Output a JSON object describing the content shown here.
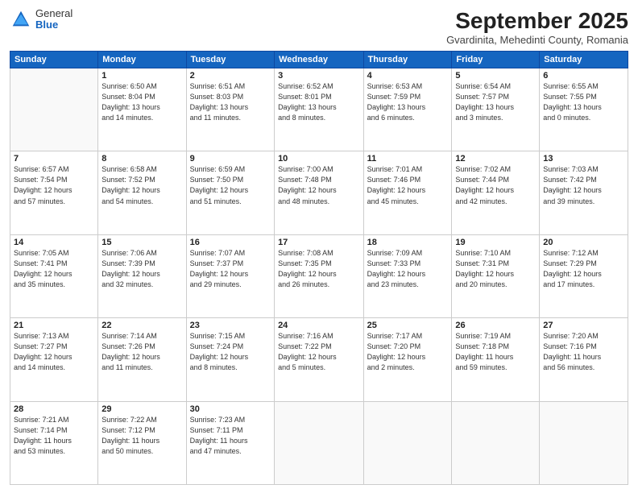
{
  "logo": {
    "general": "General",
    "blue": "Blue"
  },
  "title": "September 2025",
  "location": "Gvardinita, Mehedinti County, Romania",
  "headers": [
    "Sunday",
    "Monday",
    "Tuesday",
    "Wednesday",
    "Thursday",
    "Friday",
    "Saturday"
  ],
  "weeks": [
    [
      {
        "day": "",
        "info": ""
      },
      {
        "day": "1",
        "info": "Sunrise: 6:50 AM\nSunset: 8:04 PM\nDaylight: 13 hours\nand 14 minutes."
      },
      {
        "day": "2",
        "info": "Sunrise: 6:51 AM\nSunset: 8:03 PM\nDaylight: 13 hours\nand 11 minutes."
      },
      {
        "day": "3",
        "info": "Sunrise: 6:52 AM\nSunset: 8:01 PM\nDaylight: 13 hours\nand 8 minutes."
      },
      {
        "day": "4",
        "info": "Sunrise: 6:53 AM\nSunset: 7:59 PM\nDaylight: 13 hours\nand 6 minutes."
      },
      {
        "day": "5",
        "info": "Sunrise: 6:54 AM\nSunset: 7:57 PM\nDaylight: 13 hours\nand 3 minutes."
      },
      {
        "day": "6",
        "info": "Sunrise: 6:55 AM\nSunset: 7:55 PM\nDaylight: 13 hours\nand 0 minutes."
      }
    ],
    [
      {
        "day": "7",
        "info": "Sunrise: 6:57 AM\nSunset: 7:54 PM\nDaylight: 12 hours\nand 57 minutes."
      },
      {
        "day": "8",
        "info": "Sunrise: 6:58 AM\nSunset: 7:52 PM\nDaylight: 12 hours\nand 54 minutes."
      },
      {
        "day": "9",
        "info": "Sunrise: 6:59 AM\nSunset: 7:50 PM\nDaylight: 12 hours\nand 51 minutes."
      },
      {
        "day": "10",
        "info": "Sunrise: 7:00 AM\nSunset: 7:48 PM\nDaylight: 12 hours\nand 48 minutes."
      },
      {
        "day": "11",
        "info": "Sunrise: 7:01 AM\nSunset: 7:46 PM\nDaylight: 12 hours\nand 45 minutes."
      },
      {
        "day": "12",
        "info": "Sunrise: 7:02 AM\nSunset: 7:44 PM\nDaylight: 12 hours\nand 42 minutes."
      },
      {
        "day": "13",
        "info": "Sunrise: 7:03 AM\nSunset: 7:42 PM\nDaylight: 12 hours\nand 39 minutes."
      }
    ],
    [
      {
        "day": "14",
        "info": "Sunrise: 7:05 AM\nSunset: 7:41 PM\nDaylight: 12 hours\nand 35 minutes."
      },
      {
        "day": "15",
        "info": "Sunrise: 7:06 AM\nSunset: 7:39 PM\nDaylight: 12 hours\nand 32 minutes."
      },
      {
        "day": "16",
        "info": "Sunrise: 7:07 AM\nSunset: 7:37 PM\nDaylight: 12 hours\nand 29 minutes."
      },
      {
        "day": "17",
        "info": "Sunrise: 7:08 AM\nSunset: 7:35 PM\nDaylight: 12 hours\nand 26 minutes."
      },
      {
        "day": "18",
        "info": "Sunrise: 7:09 AM\nSunset: 7:33 PM\nDaylight: 12 hours\nand 23 minutes."
      },
      {
        "day": "19",
        "info": "Sunrise: 7:10 AM\nSunset: 7:31 PM\nDaylight: 12 hours\nand 20 minutes."
      },
      {
        "day": "20",
        "info": "Sunrise: 7:12 AM\nSunset: 7:29 PM\nDaylight: 12 hours\nand 17 minutes."
      }
    ],
    [
      {
        "day": "21",
        "info": "Sunrise: 7:13 AM\nSunset: 7:27 PM\nDaylight: 12 hours\nand 14 minutes."
      },
      {
        "day": "22",
        "info": "Sunrise: 7:14 AM\nSunset: 7:26 PM\nDaylight: 12 hours\nand 11 minutes."
      },
      {
        "day": "23",
        "info": "Sunrise: 7:15 AM\nSunset: 7:24 PM\nDaylight: 12 hours\nand 8 minutes."
      },
      {
        "day": "24",
        "info": "Sunrise: 7:16 AM\nSunset: 7:22 PM\nDaylight: 12 hours\nand 5 minutes."
      },
      {
        "day": "25",
        "info": "Sunrise: 7:17 AM\nSunset: 7:20 PM\nDaylight: 12 hours\nand 2 minutes."
      },
      {
        "day": "26",
        "info": "Sunrise: 7:19 AM\nSunset: 7:18 PM\nDaylight: 11 hours\nand 59 minutes."
      },
      {
        "day": "27",
        "info": "Sunrise: 7:20 AM\nSunset: 7:16 PM\nDaylight: 11 hours\nand 56 minutes."
      }
    ],
    [
      {
        "day": "28",
        "info": "Sunrise: 7:21 AM\nSunset: 7:14 PM\nDaylight: 11 hours\nand 53 minutes."
      },
      {
        "day": "29",
        "info": "Sunrise: 7:22 AM\nSunset: 7:12 PM\nDaylight: 11 hours\nand 50 minutes."
      },
      {
        "day": "30",
        "info": "Sunrise: 7:23 AM\nSunset: 7:11 PM\nDaylight: 11 hours\nand 47 minutes."
      },
      {
        "day": "",
        "info": ""
      },
      {
        "day": "",
        "info": ""
      },
      {
        "day": "",
        "info": ""
      },
      {
        "day": "",
        "info": ""
      }
    ]
  ]
}
